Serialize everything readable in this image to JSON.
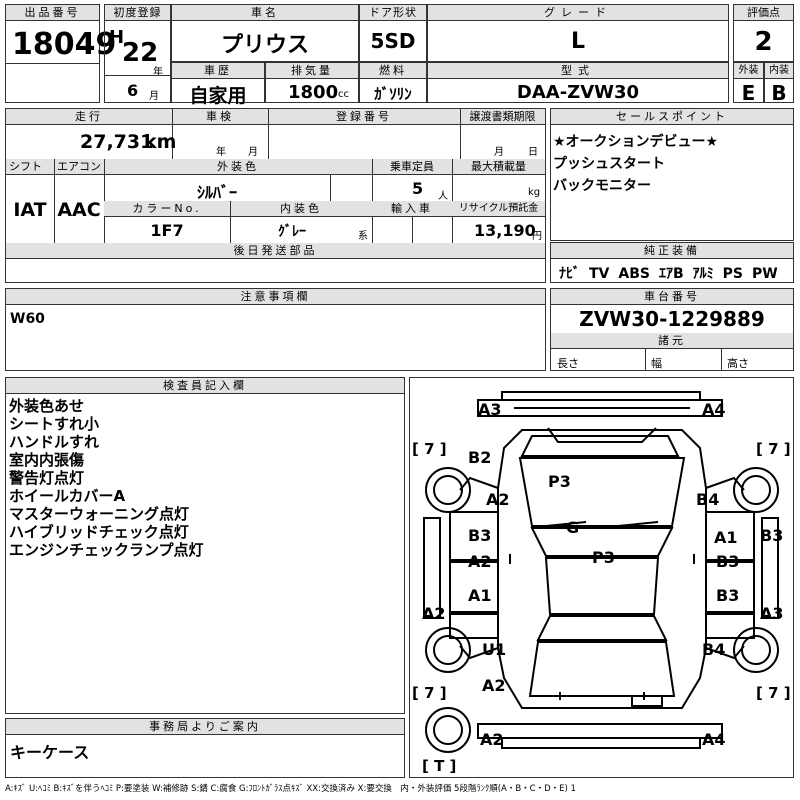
{
  "top": {
    "lot_header": "出品番号",
    "lot_no": "18049",
    "first_reg_header": "初度登録",
    "era": "H",
    "year": "22",
    "year_unit": "年",
    "month": "6",
    "month_unit": "月",
    "model_header": "車名",
    "model": "プリウス",
    "door_header": "ドア形状",
    "door": "5SD",
    "grade_header": "グレード",
    "grade": "L",
    "score_header": "評価点",
    "score": "2",
    "history_header": "車歴",
    "history": "自家用",
    "displacement_header": "排気量",
    "displacement": "1800",
    "displacement_unit": "cc",
    "fuel_header": "燃料",
    "fuel": "ｶﾞｿﾘﾝ",
    "type_header": "型式",
    "type": "DAA-ZVW30",
    "ext_header": "外装",
    "ext_grade": "E",
    "int_header": "内装",
    "int_grade": "B"
  },
  "second": {
    "mileage_header": "走行",
    "mileage": "27,731",
    "mileage_unit": "km",
    "inspection_header": "車検",
    "year_unit": "年",
    "month_unit": "月",
    "regno_header": "登録番号",
    "transfer_header": "譲渡書類期限",
    "day_unit": "日",
    "shift_header": "シフト",
    "shift": "IAT",
    "ac_header": "エアコン",
    "ac": "AAC",
    "color_header": "外装色",
    "color": "ｼﾙﾊﾞｰ",
    "capacity_header": "乗車定員",
    "capacity": "5",
    "capacity_unit": "人",
    "load_header": "最大積載量",
    "load_unit": "kg",
    "color_no_header": "カラーNo.",
    "color_no": "1F7",
    "interior_color_header": "内装色",
    "interior_color": "ｸﾞﾚｰ",
    "interior_color_unit": "系",
    "import_header": "輸入車",
    "recycle_header": "リサイクル預託金",
    "recycle": "13,190",
    "recycle_unit": "円",
    "later_header": "後日発送部品"
  },
  "sales": {
    "header": "セールスポイント",
    "items": [
      "★オークションデビュー★",
      "プッシュスタート",
      "バックモニター"
    ]
  },
  "equipment": {
    "header": "純正装備",
    "items": [
      "ﾅﾋﾞ",
      "TV",
      "ABS",
      "ｴｱB",
      "ｱﾙﾐ",
      "PS",
      "PW"
    ]
  },
  "notes": {
    "header": "注意事項欄",
    "text": "W60"
  },
  "chassis": {
    "header": "車台番号",
    "number": "ZVW30-1229889",
    "spec_header": "諸元",
    "length": "長さ",
    "width": "幅",
    "height": "高さ"
  },
  "inspector": {
    "header": "検査員記入欄",
    "items": [
      "外装色あせ",
      "シートすれ小",
      "ハンドルすれ",
      "室内内張傷",
      "警告灯点灯",
      "ホイールカバーA",
      "マスターウォーニング点灯",
      "ハイブリッドチェック点灯",
      "エンジンチェックランプ点灯"
    ]
  },
  "office": {
    "header": "事務局よりご案内",
    "text": "キーケース"
  },
  "legend": "A:ｷｽﾞ U:ﾍｺﾐ B:ｷｽﾞを伴うﾍｺﾐ P:要塗装 W:補修跡 S:錆 C:腐食 G:ﾌﾛﾝﾄｶﾞﾗｽ点ｷｽﾞ XX:交換済み X:要交換　内・外装評価 5段階ﾗﾝｸ順(A・B・C・D・E) 1",
  "diagram": {
    "tread_fl": "[ 7 ]",
    "tread_fr": "[ 7 ]",
    "tread_rl": "[ 7 ]",
    "tread_rr": "[ 7 ]",
    "tread_t": "[ T ]",
    "marks": {
      "a3_top_left": "A3",
      "a4_top_right": "A4",
      "b2_front_left": "B2",
      "a2_left_front": "A2",
      "p3_hood": "P3",
      "b4_front_right": "B4",
      "b3_left": "B3",
      "a2_left_door": "A2",
      "g_glass": "G",
      "p3_roof": "P3",
      "a1_right_door": "A1",
      "b3_right_door": "B3",
      "b3_right_side": "B3",
      "a1_left_rear": "A1",
      "b3_right_rear": "B3",
      "a2_left_side": "A2",
      "a3_right_side": "A3",
      "u1_rear_left": "U1",
      "b4_rear_right": "B4",
      "a2_rear_left": "A2",
      "a2_bottom_left": "A2",
      "a4_bottom_right": "A4"
    }
  }
}
